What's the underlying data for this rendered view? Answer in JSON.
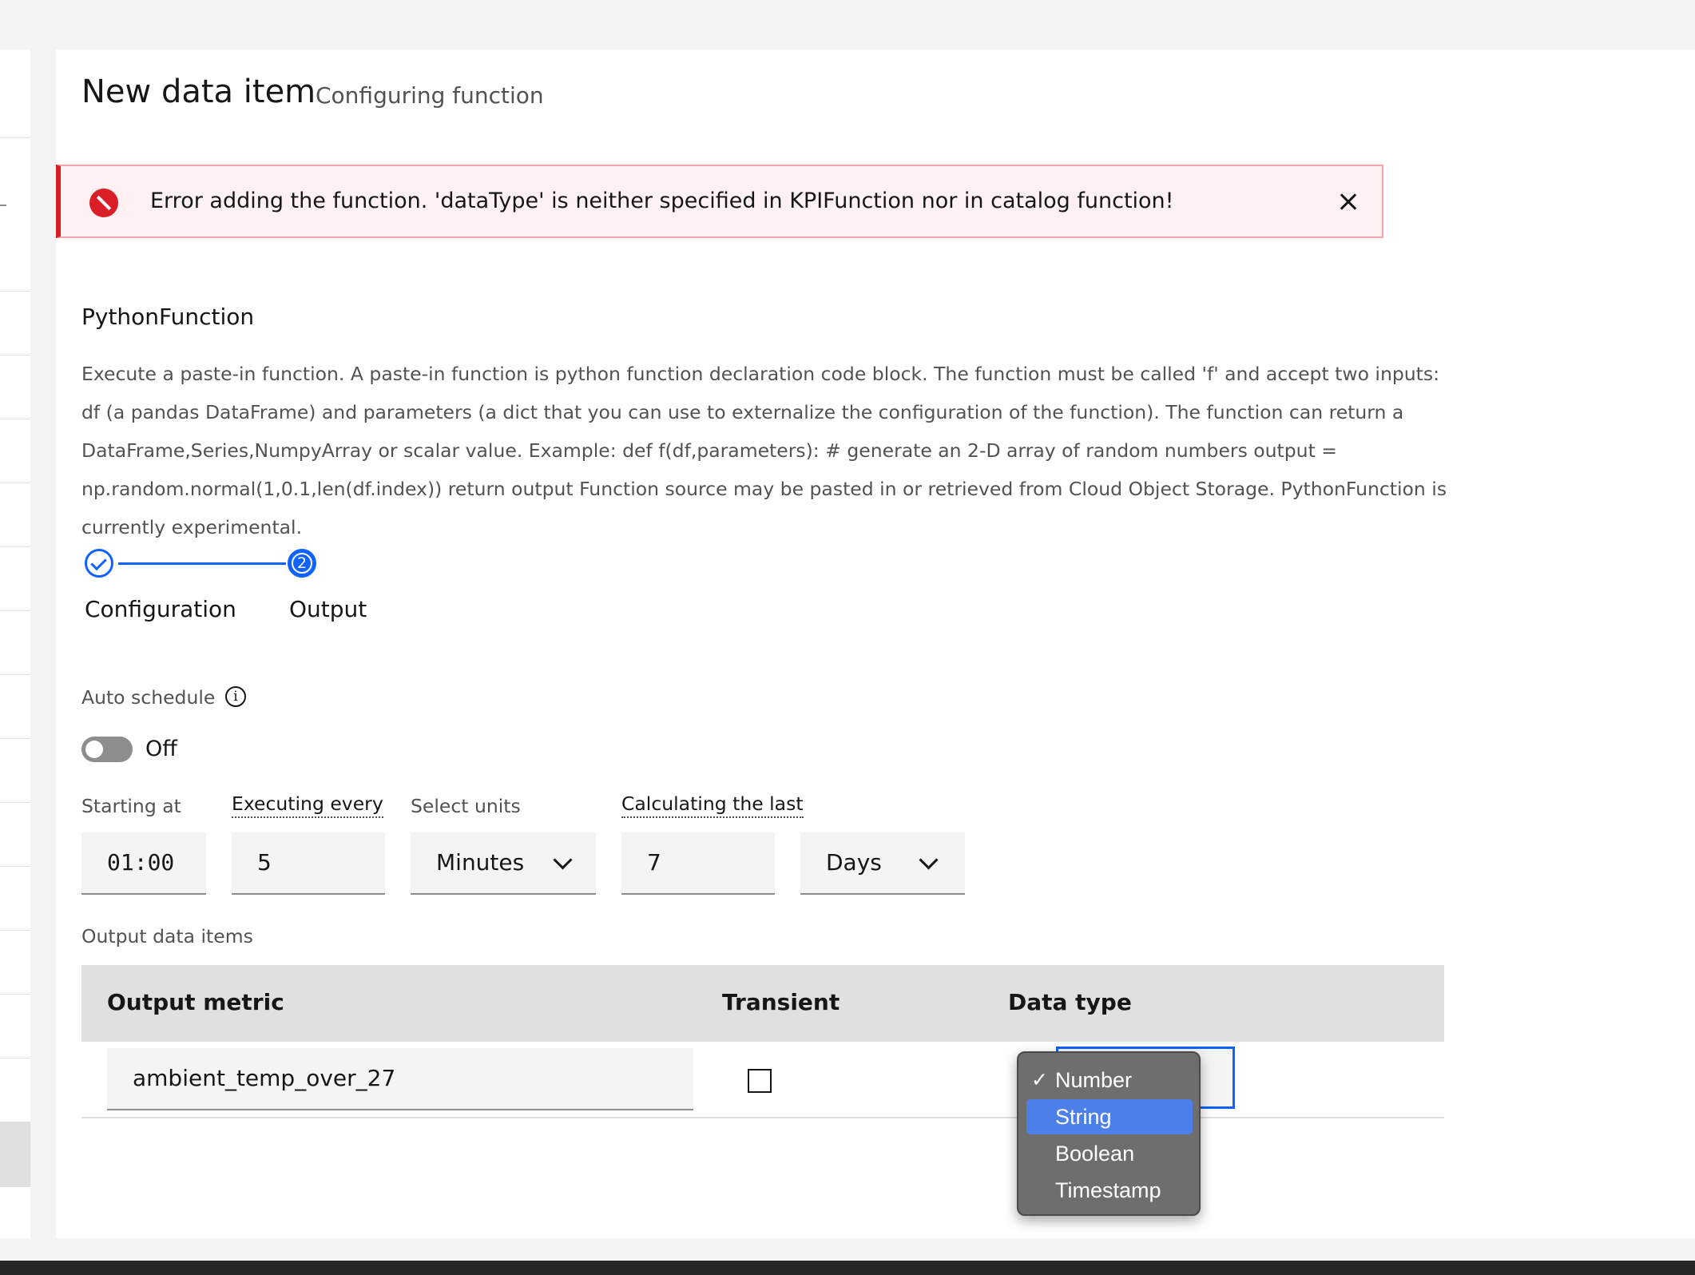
{
  "header": {
    "title": "New data item",
    "subtitle": "Configuring function"
  },
  "error": {
    "message": "Error adding the function. 'dataType' is neither specified in KPIFunction nor in catalog function!"
  },
  "function": {
    "name": "PythonFunction",
    "description": "Execute a paste-in function. A paste-in function is python function declaration code block. The function must be called 'f' and accept two inputs: df (a pandas DataFrame) and parameters (a dict that you can use to externalize the configuration of the function). The function can return a DataFrame,Series,NumpyArray or scalar value. Example: def f(df,parameters): # generate an 2-D array of random numbers output = np.random.normal(1,0.1,len(df.index)) return output Function source may be pasted in or retrieved from Cloud Object Storage. PythonFunction is currently experimental."
  },
  "steps": [
    {
      "label": "Configuration",
      "state": "complete"
    },
    {
      "label": "Output",
      "state": "current",
      "number": "2"
    }
  ],
  "schedule": {
    "auto_label": "Auto schedule",
    "toggle_text": "Off",
    "starting_at_label": "Starting at",
    "starting_at_value": "01:00",
    "executing_every_label": "Executing every",
    "executing_every_value": "5",
    "select_units_label": "Select units",
    "units_value": "Minutes",
    "calculating_last_label": "Calculating the last",
    "calculating_last_value": "7",
    "period_value": "Days"
  },
  "output": {
    "section_label": "Output data items",
    "columns": [
      "Output metric",
      "Transient",
      "Data type"
    ],
    "rows": [
      {
        "metric": "ambient_temp_over_27",
        "transient": false
      }
    ]
  },
  "datatype_dropdown": {
    "options": [
      "Number",
      "String",
      "Boolean",
      "Timestamp"
    ],
    "selected": "Number",
    "highlighted": "String"
  },
  "colors": {
    "accent": "#0f62fe",
    "error": "#da1e28",
    "error_bg": "#fff1f1",
    "dropdown_bg": "#6e6e6e",
    "dropdown_highlight": "#4d7fe8"
  }
}
